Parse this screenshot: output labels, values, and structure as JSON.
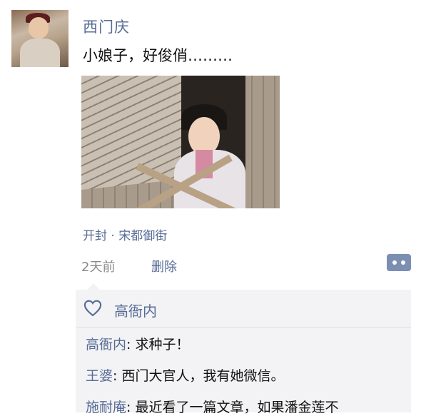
{
  "post": {
    "author": "西门庆",
    "text": "小娘子，好俊俏………",
    "location": "开封 · 宋都御街",
    "time": "2天前",
    "delete_label": "删除"
  },
  "likes": {
    "names": "高衙内"
  },
  "comments": [
    {
      "author": "高衙内",
      "sep": ": ",
      "text": "求种子！"
    },
    {
      "author": "王婆",
      "sep": ": ",
      "text": "西门大官人，我有她微信。"
    },
    {
      "author": "施耐庵",
      "sep": ": ",
      "text": "最近看了一篇文章，如果潘金莲不"
    }
  ],
  "colors": {
    "link": "#576b95",
    "panel": "#f3f3f5"
  },
  "icons": {
    "like": "heart-outline-icon",
    "comment": "comment-dots-icon"
  }
}
